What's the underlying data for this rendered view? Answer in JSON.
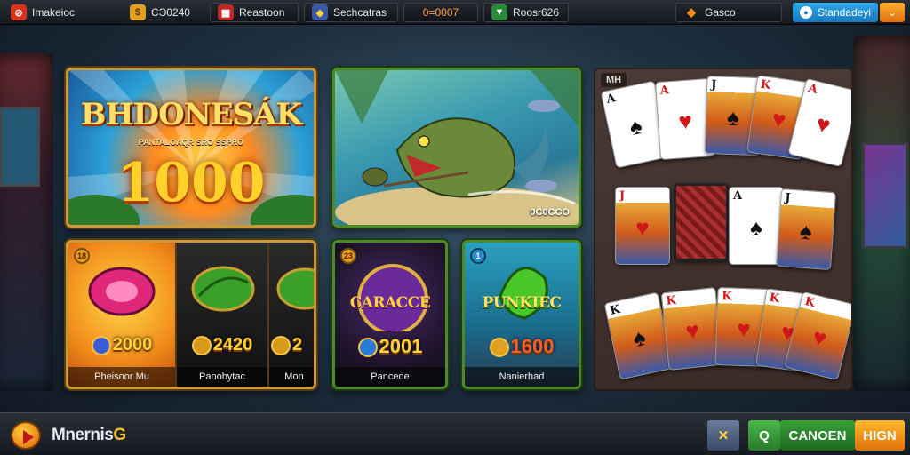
{
  "topbar": {
    "app_name": "Imakeioc",
    "items": [
      {
        "label": "ЄЭ0240"
      },
      {
        "label": "Reastoon"
      },
      {
        "label": "Sechcatras"
      },
      {
        "label": "0=0007"
      },
      {
        "label": "Roosr626"
      },
      {
        "label": "Gasco"
      }
    ],
    "standby_label": "Standadeyi"
  },
  "featured": {
    "hero1": {
      "title": "BHDONESÁK",
      "subtitle": "PANTALOAQR SRO SSPRO",
      "amount": "1000"
    },
    "hero2": {
      "tag": "0C0CCO"
    }
  },
  "games": [
    {
      "badge": "18",
      "value": "2000",
      "label": "Pheisoor Mu"
    },
    {
      "value": "2420",
      "label": "Panobytac"
    },
    {
      "value": "2",
      "label": "Mon"
    },
    {
      "badge": "23",
      "title": "CARACCE",
      "value": "2001",
      "label": "Pancede"
    },
    {
      "badge": "1",
      "title": "PUNKIEC",
      "value": "1600",
      "label": "Nanierhad"
    }
  ],
  "cards_panel": {
    "header": "MH",
    "cards": [
      {
        "rank": "A",
        "suit": "♠"
      },
      {
        "rank": "A",
        "suit": "♥"
      },
      {
        "rank": "J",
        "suit": "♠"
      },
      {
        "rank": "K",
        "suit": "♥"
      },
      {
        "rank": "A",
        "suit": "♥"
      },
      {
        "rank": "J",
        "suit": "♥"
      },
      {
        "rank": "",
        "suit": ""
      },
      {
        "rank": "A",
        "suit": "♠"
      },
      {
        "rank": "J",
        "suit": "♠"
      },
      {
        "rank": "K",
        "suit": "♠"
      },
      {
        "rank": "K",
        "suit": "♥"
      },
      {
        "rank": "K",
        "suit": "♥"
      },
      {
        "rank": "K",
        "suit": "♥"
      },
      {
        "rank": "K",
        "suit": "♥"
      }
    ]
  },
  "bottombar": {
    "brand_main": "Mnernis",
    "brand_accent": "G",
    "btn_x": "✕",
    "btn_q": "Q",
    "btn_cancel": "CANOEN",
    "btn_high": "HIGN"
  },
  "colors": {
    "accent_blue": "#1f8fd6",
    "accent_orange": "#f08a18",
    "accent_green": "#3a9a3a",
    "gold": "#ffd23a"
  }
}
